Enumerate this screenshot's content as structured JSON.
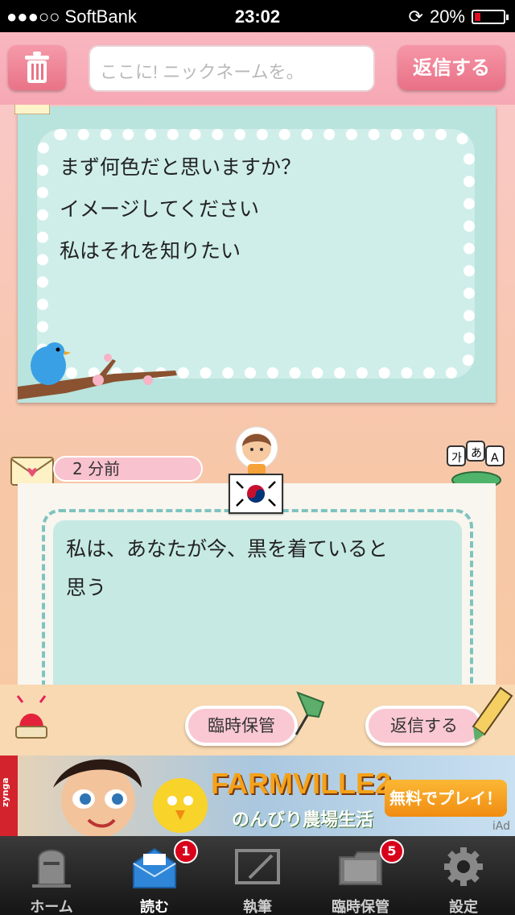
{
  "status_bar": {
    "carrier": "●●●○○ SoftBank",
    "time": "23:02",
    "battery_percent": "20%",
    "battery_level": 0.2
  },
  "topbar": {
    "nickname_placeholder": "ここに! ニックネームを。",
    "reply_label": "返信する"
  },
  "message_card": {
    "lines": [
      "まず何色だと思いますか？",
      "イメージしてください",
      "私はそれを知りたい"
    ]
  },
  "reply_card": {
    "time_ago": "2 分前",
    "lines": [
      "私は、あなたが今、黒を着ていると",
      "思う"
    ]
  },
  "actions": {
    "save_label": "臨時保管",
    "reply_label": "返信する"
  },
  "ad": {
    "brand": "zynga",
    "title": "FARMVILLE2",
    "subtitle": "のんびり農場生活",
    "cta": "無料でプレイ！",
    "iad": "iAd"
  },
  "tabbar": {
    "items": [
      {
        "label": "ホーム",
        "icon": "mailbox-icon"
      },
      {
        "label": "読む",
        "icon": "open-mail-icon",
        "badge": "1"
      },
      {
        "label": "執筆",
        "icon": "write-icon"
      },
      {
        "label": "臨時保管",
        "icon": "folder-icon",
        "badge": "5"
      },
      {
        "label": "設定",
        "icon": "gear-icon"
      }
    ]
  },
  "colors": {
    "accent_pink": "#f6a8b4",
    "card_mint": "#b9e3dd",
    "badge_red": "#d9001b"
  }
}
